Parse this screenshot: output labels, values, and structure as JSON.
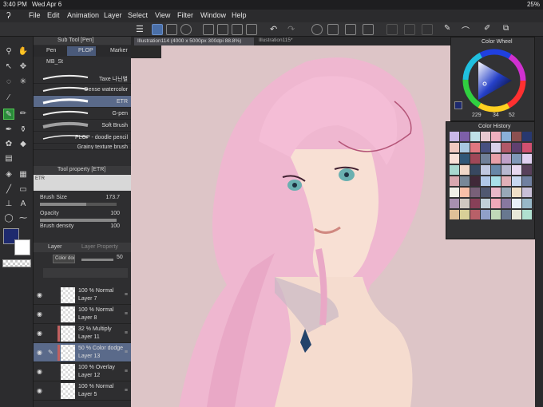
{
  "status": {
    "time": "3:40 PM",
    "date": "Wed Apr 6",
    "battery": "25%"
  },
  "menu": [
    "File",
    "Edit",
    "Animation",
    "Layer",
    "Select",
    "View",
    "Filter",
    "Window",
    "Help"
  ],
  "toolbar_icons": [
    "hamburger-icon",
    "pen-tool-icon",
    "undo-icon",
    "redo-icon"
  ],
  "subtool": {
    "title": "Sub Tool [Pen]",
    "tabs": [
      "Pen",
      "PLOP",
      "Marker"
    ],
    "group": "MB_St",
    "brushes": [
      "Taxe 나닌별",
      "Dense watercolor",
      "ETR",
      "G-pen",
      "Soft Brush",
      "PLOP - doodle pencil",
      "Grainy texture brush"
    ]
  },
  "toolprop": {
    "title": "Tool property [ETR]",
    "preview_label": "ETR",
    "size_label": "Brush Size",
    "size_value": "173.7",
    "opacity_label": "Opacity",
    "opacity_value": "100",
    "density_label": "Brush density",
    "density_value": "100"
  },
  "layerpanel": {
    "tabs": [
      "Layer",
      "Layer Property"
    ],
    "blend_mode": "Color dodge",
    "opacity": "50",
    "layers": [
      {
        "pct": "100 %",
        "mode": "Normal",
        "name": "Layer 7"
      },
      {
        "pct": "100 %",
        "mode": "Normal",
        "name": "Layer 8"
      },
      {
        "pct": "32 %",
        "mode": "Multiply",
        "name": "Layer 11"
      },
      {
        "pct": "50 %",
        "mode": "Color dodge",
        "name": "Layer 13"
      },
      {
        "pct": "100 %",
        "mode": "Overlay",
        "name": "Layer 12"
      },
      {
        "pct": "100 %",
        "mode": "Normal",
        "name": "Layer 5"
      }
    ]
  },
  "tabs": [
    "Illustration114 (4000 x 5000px 300dpi 88.8%)",
    "Illustration115*"
  ],
  "colorwheel": {
    "title": "Color Wheel",
    "h": "229",
    "s": "34",
    "v": "52",
    "main_color": "#1e2a6e"
  },
  "colorhistory": {
    "title": "Color History",
    "swatches": [
      "#c9b8e8",
      "#7d5fa8",
      "#bfe0e8",
      "#e8c8d0",
      "#f0b0c0",
      "#8ab0d8",
      "#8c5050",
      "#283870",
      "#f0c8c0",
      "#a8c8e0",
      "#e07880",
      "#485080",
      "#d8d0e8",
      "#b05868",
      "#604070",
      "#d05070",
      "#f8e0d8",
      "#305878",
      "#a04858",
      "#708098",
      "#e8a0a8",
      "#c0a0c8",
      "#8098b8",
      "#e0d0f0",
      "#a8d8d0",
      "#f0d8c8",
      "#384860",
      "#c0c8e0",
      "#6888a8",
      "#b8b8d0",
      "#e8d8f0",
      "#58405a",
      "#d8a8b0",
      "#788898",
      "#402838",
      "#b0c8e8",
      "#a8e0e8",
      "#e0b0b8",
      "#c8d8f0",
      "#7080a0",
      "#f0f0e8",
      "#f8c0a8",
      "#786078",
      "#505870",
      "#e8b8c8",
      "#98a8b8",
      "#f0e0c8",
      "#c8c0d8",
      "#a890b0",
      "#d0c8c0",
      "#884058",
      "#c0d0d8",
      "#f0a8b8",
      "#8878a0",
      "#e8f0f8",
      "#98b8c8",
      "#e0c098",
      "#d8d098",
      "#b86068",
      "#90a0c8",
      "#c0d8b8",
      "#687890",
      "#e8e8d8",
      "#b0e0d0"
    ]
  }
}
